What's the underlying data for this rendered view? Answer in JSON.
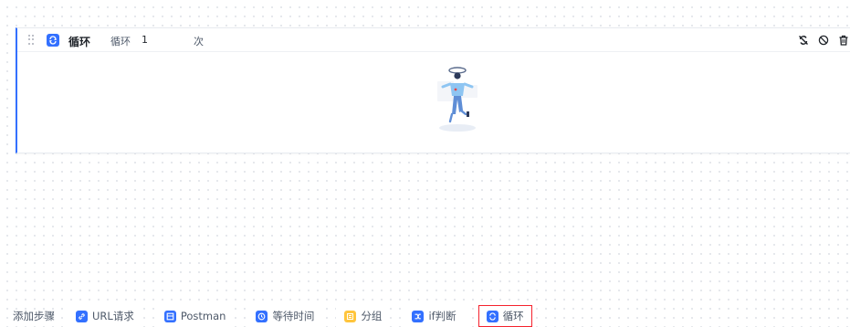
{
  "loop_step": {
    "title": "循环",
    "loop_label": "循环",
    "loop_count": "1",
    "loop_unit": "次",
    "accent_color": "#3370ff"
  },
  "header_icons": [
    "refresh-off-icon",
    "disable-icon",
    "delete-icon"
  ],
  "add_step": {
    "label": "添加步骤",
    "buttons": [
      {
        "label": "URL请求",
        "icon": "link-icon",
        "color": "#3370ff"
      },
      {
        "label": "Postman",
        "icon": "postman-icon",
        "color": "#3370ff"
      },
      {
        "label": "等待时间",
        "icon": "clock-icon",
        "color": "#3370ff"
      },
      {
        "label": "分组",
        "icon": "group-icon",
        "color": "#ffc53d"
      },
      {
        "label": "if判断",
        "icon": "branch-icon",
        "color": "#3370ff"
      },
      {
        "label": "循环",
        "icon": "loop-icon",
        "color": "#3370ff",
        "selected": true
      }
    ]
  }
}
